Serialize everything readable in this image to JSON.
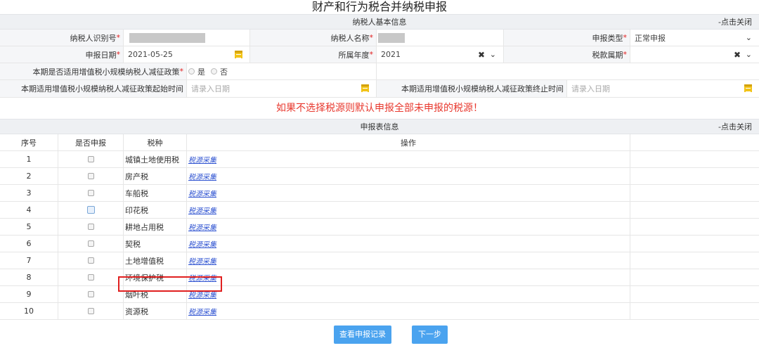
{
  "title": "财产和行为税合并纳税申报",
  "basic_info": {
    "section_label": "纳税人基本信息",
    "toggle_label": "-点击关闭",
    "taxpayer_id_label": "纳税人识别号",
    "taxpayer_name_label": "纳税人名称",
    "declare_type_label": "申报类型",
    "declare_type_value": "正常申报",
    "declare_date_label": "申报日期",
    "declare_date_value": "2021-05-25",
    "year_label": "所属年度",
    "year_value": "2021",
    "period_label": "税款属期",
    "period_value": "",
    "policy_label": "本期是否适用增值税小规模纳税人减征政策",
    "policy_yes": "是",
    "policy_no": "否",
    "policy_start_label": "本期适用增值税小规模纳税人减征政策起始时间",
    "policy_start_placeholder": "请录入日期",
    "policy_end_label": "本期适用增值税小规模纳税人减征政策终止时间",
    "policy_end_placeholder": "请录入日期",
    "required_mark": "*"
  },
  "warning": "如果不选择税源则默认申报全部未申报的税源！",
  "declare_table": {
    "section_label": "申报表信息",
    "toggle_label": "-点击关闭",
    "columns": [
      "序号",
      "是否申报",
      "税种",
      "操作"
    ],
    "rows": [
      {
        "no": "1",
        "tax": "城镇土地使用税",
        "action": "税源采集"
      },
      {
        "no": "2",
        "tax": "房产税",
        "action": "税源采集"
      },
      {
        "no": "3",
        "tax": "车船税",
        "action": "税源采集"
      },
      {
        "no": "4",
        "tax": "印花税",
        "action": "税源采集"
      },
      {
        "no": "5",
        "tax": "耕地占用税",
        "action": "税源采集"
      },
      {
        "no": "6",
        "tax": "契税",
        "action": "税源采集"
      },
      {
        "no": "7",
        "tax": "土地增值税",
        "action": "税源采集"
      },
      {
        "no": "8",
        "tax": "环境保护税",
        "action": "税源采集"
      },
      {
        "no": "9",
        "tax": "烟叶税",
        "action": "税源采集"
      },
      {
        "no": "10",
        "tax": "资源税",
        "action": "税源采集"
      }
    ]
  },
  "buttons": {
    "history": "查看申报记录",
    "next": "下一步"
  },
  "colors": {
    "accent": "#4aa3ef",
    "warning": "#e8382e",
    "link": "#2a4fd0",
    "highlight": "#e02020"
  }
}
